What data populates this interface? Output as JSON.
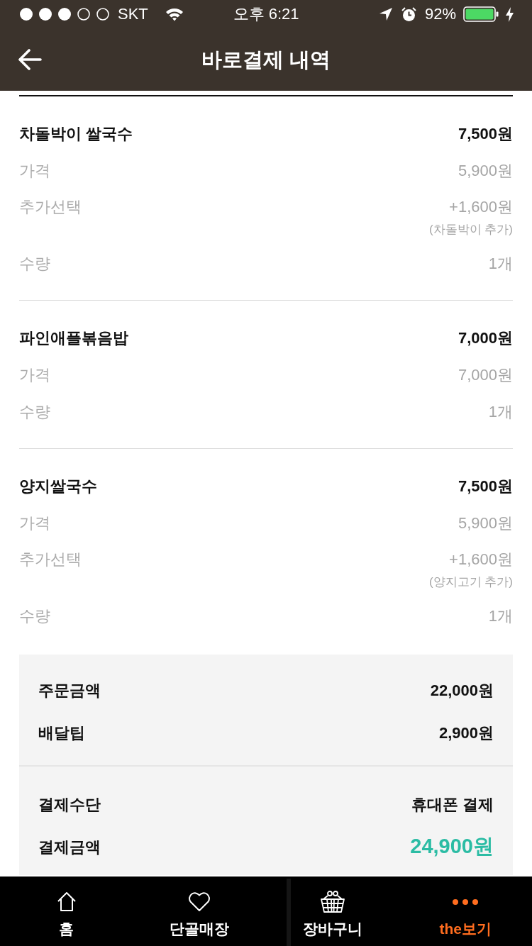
{
  "status_bar": {
    "carrier": "SKT",
    "time": "오후 6:21",
    "battery": "92%"
  },
  "header": {
    "title": "바로결제 내역"
  },
  "order_items": [
    {
      "name": "차돌박이 쌀국수",
      "total": "7,500원",
      "details": [
        {
          "label": "가격",
          "value": "5,900원"
        },
        {
          "label": "추가선택",
          "value": "+1,600원",
          "note": "(차돌박이 추가)"
        },
        {
          "label": "수량",
          "value": "1개"
        }
      ]
    },
    {
      "name": "파인애플볶음밥",
      "total": "7,000원",
      "details": [
        {
          "label": "가격",
          "value": "7,000원"
        },
        {
          "label": "수량",
          "value": "1개"
        }
      ]
    },
    {
      "name": "양지쌀국수",
      "total": "7,500원",
      "details": [
        {
          "label": "가격",
          "value": "5,900원"
        },
        {
          "label": "추가선택",
          "value": "+1,600원",
          "note": "(양지고기 추가)"
        },
        {
          "label": "수량",
          "value": "1개"
        }
      ]
    }
  ],
  "summary": {
    "groups": [
      {
        "rows": [
          {
            "label": "주문금액",
            "value": "22,000원",
            "kind": "plain"
          },
          {
            "label": "배달팁",
            "value": "2,900원",
            "kind": "plain"
          }
        ]
      },
      {
        "rows": [
          {
            "label": "결제수단",
            "value": "휴대폰 결제",
            "kind": "plain"
          },
          {
            "label": "결제금액",
            "value": "24,900원",
            "kind": "total"
          }
        ]
      }
    ]
  },
  "bottom_nav": {
    "tabs": [
      {
        "label": "홈",
        "selected": false
      },
      {
        "label": "단골매장",
        "selected": false
      },
      {
        "label": "장바구니",
        "selected": false
      },
      {
        "label": "the보기",
        "selected": true
      }
    ]
  }
}
